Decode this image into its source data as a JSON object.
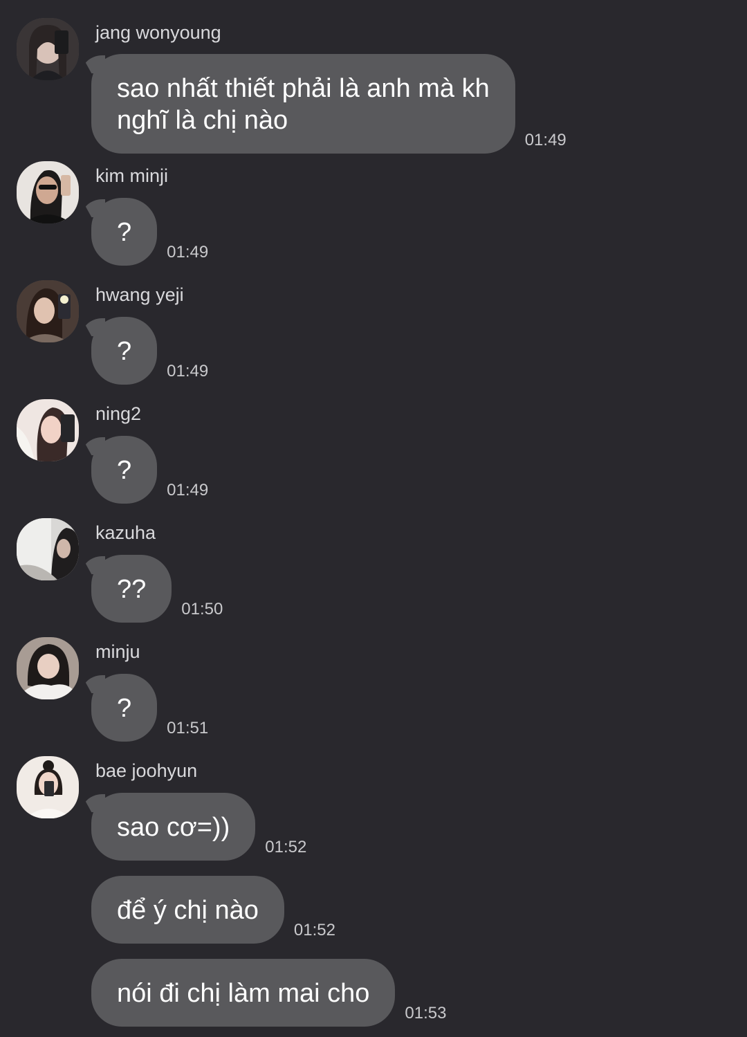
{
  "chat": {
    "messages": [
      {
        "sender": "jang wonyoung",
        "avatar_icon": "profile-photo",
        "bubbles": [
          {
            "text": "sao nhất thiết phải là anh mà kh\nnghĩ là chị nào",
            "time": "01:49"
          }
        ]
      },
      {
        "sender": "kim minji",
        "avatar_icon": "profile-photo",
        "bubbles": [
          {
            "text": "?",
            "time": "01:49"
          }
        ]
      },
      {
        "sender": "hwang yeji",
        "avatar_icon": "profile-photo",
        "bubbles": [
          {
            "text": "?",
            "time": "01:49"
          }
        ]
      },
      {
        "sender": "ning2",
        "avatar_icon": "profile-photo",
        "bubbles": [
          {
            "text": "?",
            "time": "01:49"
          }
        ]
      },
      {
        "sender": "kazuha",
        "avatar_icon": "profile-photo",
        "bubbles": [
          {
            "text": "??",
            "time": "01:50"
          }
        ]
      },
      {
        "sender": "minju",
        "avatar_icon": "profile-photo",
        "bubbles": [
          {
            "text": "?",
            "time": "01:51"
          }
        ]
      },
      {
        "sender": "bae joohyun",
        "avatar_icon": "profile-photo",
        "bubbles": [
          {
            "text": "sao cơ=))",
            "time": "01:52"
          },
          {
            "text": "để ý chị nào",
            "time": "01:52"
          },
          {
            "text": "nói đi chị làm mai cho",
            "time": "01:53"
          }
        ]
      }
    ]
  },
  "colors": {
    "background": "#29282d",
    "bubble": "#59595c",
    "text": "#ffffff",
    "sender": "#d9d9dc",
    "timestamp": "#c9c9cc"
  }
}
